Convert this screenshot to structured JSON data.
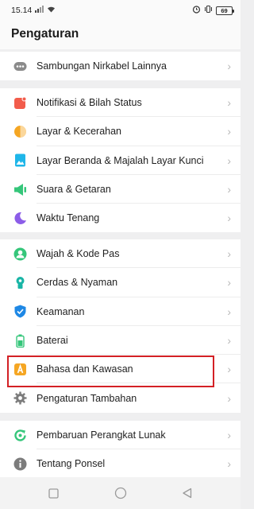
{
  "status_bar": {
    "time": "15.14",
    "battery": "69"
  },
  "header": {
    "title": "Pengaturan"
  },
  "groups": [
    {
      "items": [
        {
          "label": "Sambungan Nirkabel Lainnya",
          "icon": "more-connections-icon",
          "color": "#8a8a8a"
        }
      ]
    },
    {
      "items": [
        {
          "label": "Notifikasi & Bilah Status",
          "icon": "notification-icon",
          "color": "#f25c4b"
        },
        {
          "label": "Layar &  Kecerahan",
          "icon": "brightness-icon",
          "color": "#f5a623"
        },
        {
          "label": "Layar Beranda & Majalah Layar Kunci",
          "icon": "wallpaper-icon",
          "color": "#1fb6e9"
        },
        {
          "label": "Suara & Getaran",
          "icon": "sound-icon",
          "color": "#35c67a"
        },
        {
          "label": "Waktu Tenang",
          "icon": "moon-icon",
          "color": "#8c5de8"
        }
      ]
    },
    {
      "items": [
        {
          "label": "Wajah & Kode Pas",
          "icon": "face-icon",
          "color": "#35c67a"
        },
        {
          "label": "Cerdas & Nyaman",
          "icon": "smart-icon",
          "color": "#19b5a6"
        },
        {
          "label": "Keamanan",
          "icon": "shield-icon",
          "color": "#1e88e5"
        },
        {
          "label": "Baterai",
          "icon": "battery-icon",
          "color": "#35c67a"
        },
        {
          "label": "Bahasa dan Kawasan",
          "icon": "language-icon",
          "color": "#f5a623"
        },
        {
          "label": "Pengaturan Tambahan",
          "icon": "gear-icon",
          "color": "#7c7c7c"
        }
      ]
    },
    {
      "items": [
        {
          "label": "Pembaruan Perangkat Lunak",
          "icon": "update-icon",
          "color": "#35c67a"
        },
        {
          "label": "Tentang Ponsel",
          "icon": "info-icon",
          "color": "#7c7c7c"
        }
      ]
    }
  ],
  "highlight_color": "#d32025",
  "nav": {
    "buttons": [
      "recent-apps-icon",
      "home-icon",
      "back-icon"
    ]
  }
}
